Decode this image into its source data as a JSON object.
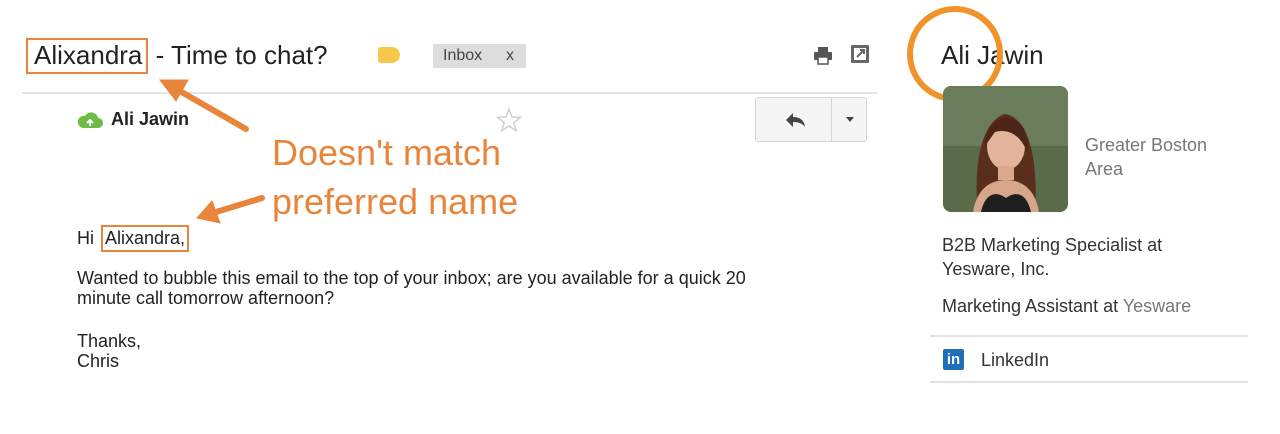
{
  "email": {
    "subject_name": "Alixandra",
    "subject_rest": " - Time to chat?",
    "inbox_chip": "Inbox",
    "inbox_chip_close": "x",
    "sender": "Ali Jawin",
    "greeting_prefix": "Hi ",
    "greeting_name": "Alixandra,",
    "body_line1": "Wanted to bubble this email to the top of your inbox; are you available for a quick 20",
    "body_line2": "minute call tomorrow afternoon?",
    "signoff": "Thanks,",
    "signature": "Chris"
  },
  "annotation": {
    "line1": "Doesn't match",
    "line2": "preferred name",
    "color": "#e8853a"
  },
  "profile": {
    "name": "Ali Jawin",
    "location": "Greater Boston Area",
    "title1": "B2B Marketing Specialist at Yesware, Inc.",
    "title2_prefix": "Marketing Assistant at ",
    "title2_company": "Yesware",
    "linkedin_label": "LinkedIn",
    "linkedin_icon_text": "in"
  },
  "colors": {
    "highlight_orange": "#e8853a",
    "circle_orange": "#f0932b",
    "label_yellow": "#f6c94c",
    "linkedin_blue": "#1d6fb8"
  }
}
